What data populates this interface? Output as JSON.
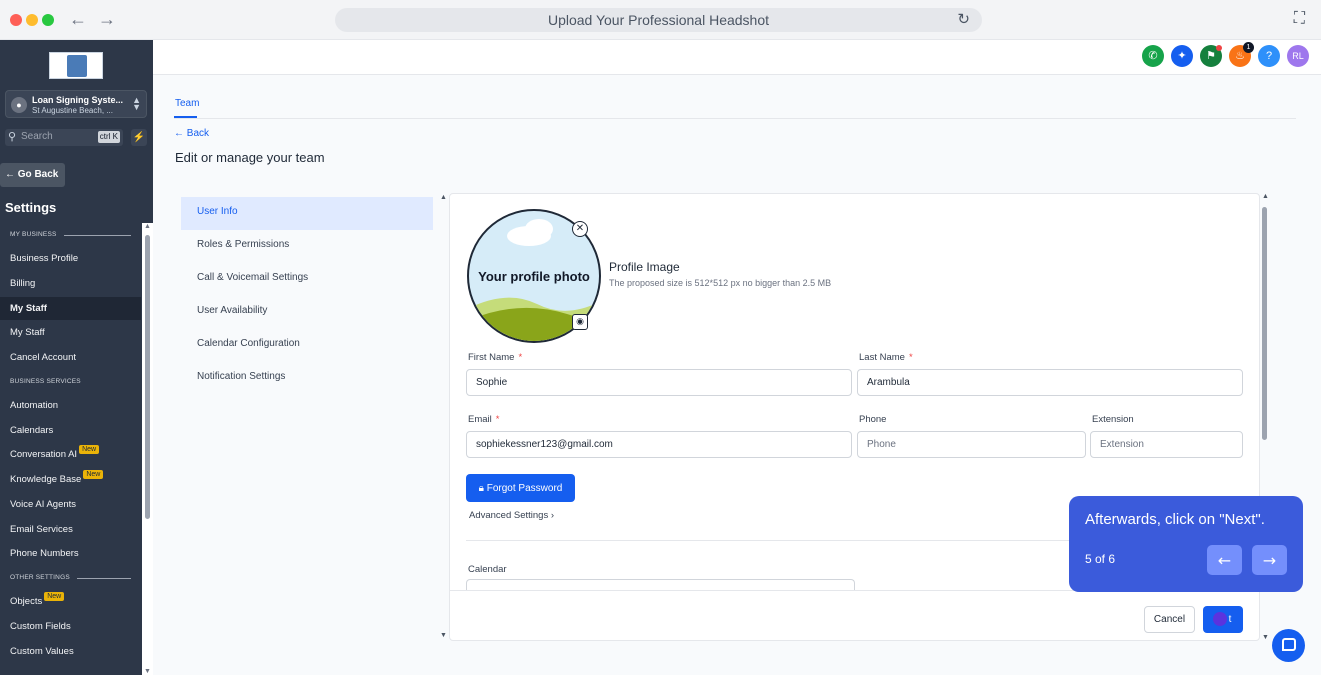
{
  "browser": {
    "title": "Upload Your Professional Headshot",
    "back_icon": "←",
    "forward_icon": "→",
    "reload_icon": "↻",
    "expand_icon": "⛶"
  },
  "sidebar": {
    "location_name": "Loan Signing Syste...",
    "location_city": "St Augustine Beach, ...",
    "search_placeholder": "Search",
    "search_shortcut": "ctrl K",
    "go_back": "Go Back",
    "settings_title": "Settings",
    "sections": {
      "my_business": "MY BUSINESS",
      "business_services": "BUSINESS SERVICES",
      "other_settings": "OTHER SETTINGS"
    },
    "items": [
      {
        "label": "Business Profile"
      },
      {
        "label": "Billing"
      },
      {
        "label": "My Staff"
      },
      {
        "label": "My Staff"
      },
      {
        "label": "Cancel Account"
      },
      {
        "label": "Automation"
      },
      {
        "label": "Calendars"
      },
      {
        "label": "Conversation AI",
        "badge": "New"
      },
      {
        "label": "Knowledge Base",
        "badge": "New"
      },
      {
        "label": "Voice AI Agents"
      },
      {
        "label": "Email Services"
      },
      {
        "label": "Phone Numbers"
      },
      {
        "label": "Objects",
        "badge": "New"
      },
      {
        "label": "Custom Fields"
      },
      {
        "label": "Custom Values"
      }
    ]
  },
  "header": {
    "notification_count": "1",
    "help": "?",
    "avatar_initials": "RL",
    "colors": {
      "phone": "#16a34a",
      "sparkle": "#155eef",
      "megaphone": "#15803d",
      "bell": "#f97316",
      "help": "#2e90fa",
      "avatar": "#9e77ed"
    }
  },
  "main": {
    "tab": "Team",
    "back": "Back",
    "title": "Edit or manage your team",
    "menu": [
      {
        "label": "User Info"
      },
      {
        "label": "Roles & Permissions"
      },
      {
        "label": "Call & Voicemail Settings"
      },
      {
        "label": "User Availability"
      },
      {
        "label": "Calendar Configuration"
      },
      {
        "label": "Notification Settings"
      }
    ]
  },
  "form": {
    "photo_text": "Your profile photo",
    "profile_image_title": "Profile Image",
    "profile_image_hint": "The proposed size is 512*512 px no bigger than 2.5 MB",
    "first_name_label": "First Name",
    "first_name_value": "Sophie",
    "last_name_label": "Last Name",
    "last_name_value": "Arambula",
    "email_label": "Email",
    "email_value": "sophiekessner123@gmail.com",
    "phone_label": "Phone",
    "phone_placeholder": "Phone",
    "extension_label": "Extension",
    "extension_placeholder": "Extension",
    "required_mark": "*",
    "forgot_password": "Forgot Password",
    "advanced_settings": "Advanced Settings",
    "calendar_label": "Calendar",
    "cancel": "Cancel",
    "next_partial": "t"
  },
  "tooltip": {
    "text": "Afterwards, click on \"Next\".",
    "step": "5 of 6",
    "prev_icon": "←",
    "next_icon": "→"
  },
  "colors": {
    "accent": "#155eef",
    "sidebar_bg": "#2d3748",
    "tooltip_bg": "#3b5bdb"
  }
}
